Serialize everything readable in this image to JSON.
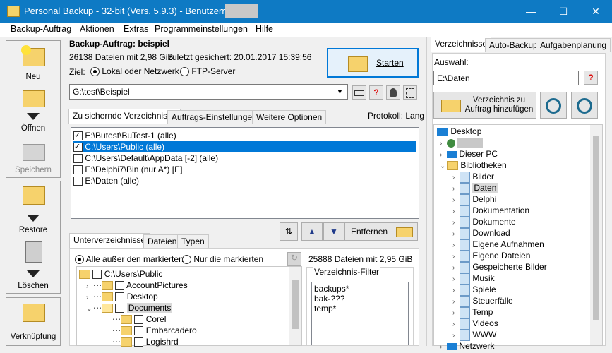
{
  "window": {
    "title": "Personal Backup - 32-bit (Vers. 5.9.3) - Benutzername:",
    "minimize": "—",
    "maximize": "☐",
    "close": "✕"
  },
  "menu": [
    "Backup-Auftrag",
    "Aktionen",
    "Extras",
    "Programmeinstellungen",
    "Hilfe"
  ],
  "toolbar": {
    "new": "Neu",
    "open": "Öffnen",
    "save": "Speichern",
    "restore": "Restore",
    "delete": "Löschen",
    "link": "Verknüpfung"
  },
  "job": {
    "title": "Backup-Auftrag: beispiel",
    "stats": "26138 Dateien mit 2,98 GiB",
    "last_saved": "zuletzt gesichert:  20.01.2017 15:39:56",
    "target_label": "Ziel:",
    "target_local": "Lokal oder Netzwerk",
    "target_ftp": "FTP-Server",
    "start_button": "Starten",
    "path": "G:\\test\\Beispiel"
  },
  "tabs_main": [
    "Zu sichernde Verzeichnisse",
    "Auftrags-Einstellungen",
    "Weitere Optionen"
  ],
  "protocol": "Protokoll: Lang",
  "dir_list": [
    {
      "label": "E:\\Butest\\BuTest-1 (alle)",
      "checked": true,
      "selected": false
    },
    {
      "label": "C:\\Users\\Public (alle)",
      "checked": true,
      "selected": true
    },
    {
      "label": "C:\\Users\\Default\\AppData [-2] (alle)",
      "checked": false,
      "selected": false
    },
    {
      "label": "E:\\Delphi7\\Bin (nur A*) [E]",
      "checked": false,
      "selected": false
    },
    {
      "label": "E:\\Daten (alle)",
      "checked": false,
      "selected": false
    }
  ],
  "remove_button": "Entfernen",
  "tabs_sub": [
    "Unterverzeichnisse",
    "Dateien",
    "Typen"
  ],
  "sub": {
    "radio_all_except": "Alle außer den markierten",
    "radio_only": "Nur die markierten",
    "stats": "25888 Dateien mit 2,95 GiB",
    "filter_title": "Verzeichnis-Filter",
    "filters": [
      "backups*",
      "bak-???",
      "temp*"
    ]
  },
  "subtree": [
    {
      "label": "C:\\Users\\Public",
      "level": 0
    },
    {
      "label": "AccountPictures",
      "level": 1
    },
    {
      "label": "Desktop",
      "level": 1
    },
    {
      "label": "Documents",
      "level": 1
    },
    {
      "label": "Corel",
      "level": 2
    },
    {
      "label": "Embarcadero",
      "level": 2
    },
    {
      "label": "Logishrd",
      "level": 2
    }
  ],
  "right": {
    "tabs": [
      "Verzeichnisse",
      "Auto-Backup",
      "Aufgabenplanung"
    ],
    "selection_label": "Auswahl:",
    "selection_value": "E:\\Daten",
    "help": "?",
    "add_button": "Verzeichnis zu Auftrag hinzufügen",
    "tree": [
      {
        "label": "Desktop",
        "level": 0
      },
      {
        "label": "",
        "level": 1
      },
      {
        "label": "Dieser PC",
        "level": 1
      },
      {
        "label": "Bibliotheken",
        "level": 1
      },
      {
        "label": "Bilder",
        "level": 2
      },
      {
        "label": "Daten",
        "level": 2
      },
      {
        "label": "Delphi",
        "level": 2
      },
      {
        "label": "Dokumentation",
        "level": 2
      },
      {
        "label": "Dokumente",
        "level": 2
      },
      {
        "label": "Download",
        "level": 2
      },
      {
        "label": "Eigene Aufnahmen",
        "level": 2
      },
      {
        "label": "Eigene Dateien",
        "level": 2
      },
      {
        "label": "Gespeicherte Bilder",
        "level": 2
      },
      {
        "label": "Musik",
        "level": 2
      },
      {
        "label": "Spiele",
        "level": 2
      },
      {
        "label": "Steuerfälle",
        "level": 2
      },
      {
        "label": "Temp",
        "level": 2
      },
      {
        "label": "Videos",
        "level": 2
      },
      {
        "label": "WWW",
        "level": 2
      },
      {
        "label": "Netzwerk",
        "level": 1
      }
    ]
  },
  "colors": {
    "titlebar": "#0e7ac4",
    "selection": "#0078d7"
  }
}
